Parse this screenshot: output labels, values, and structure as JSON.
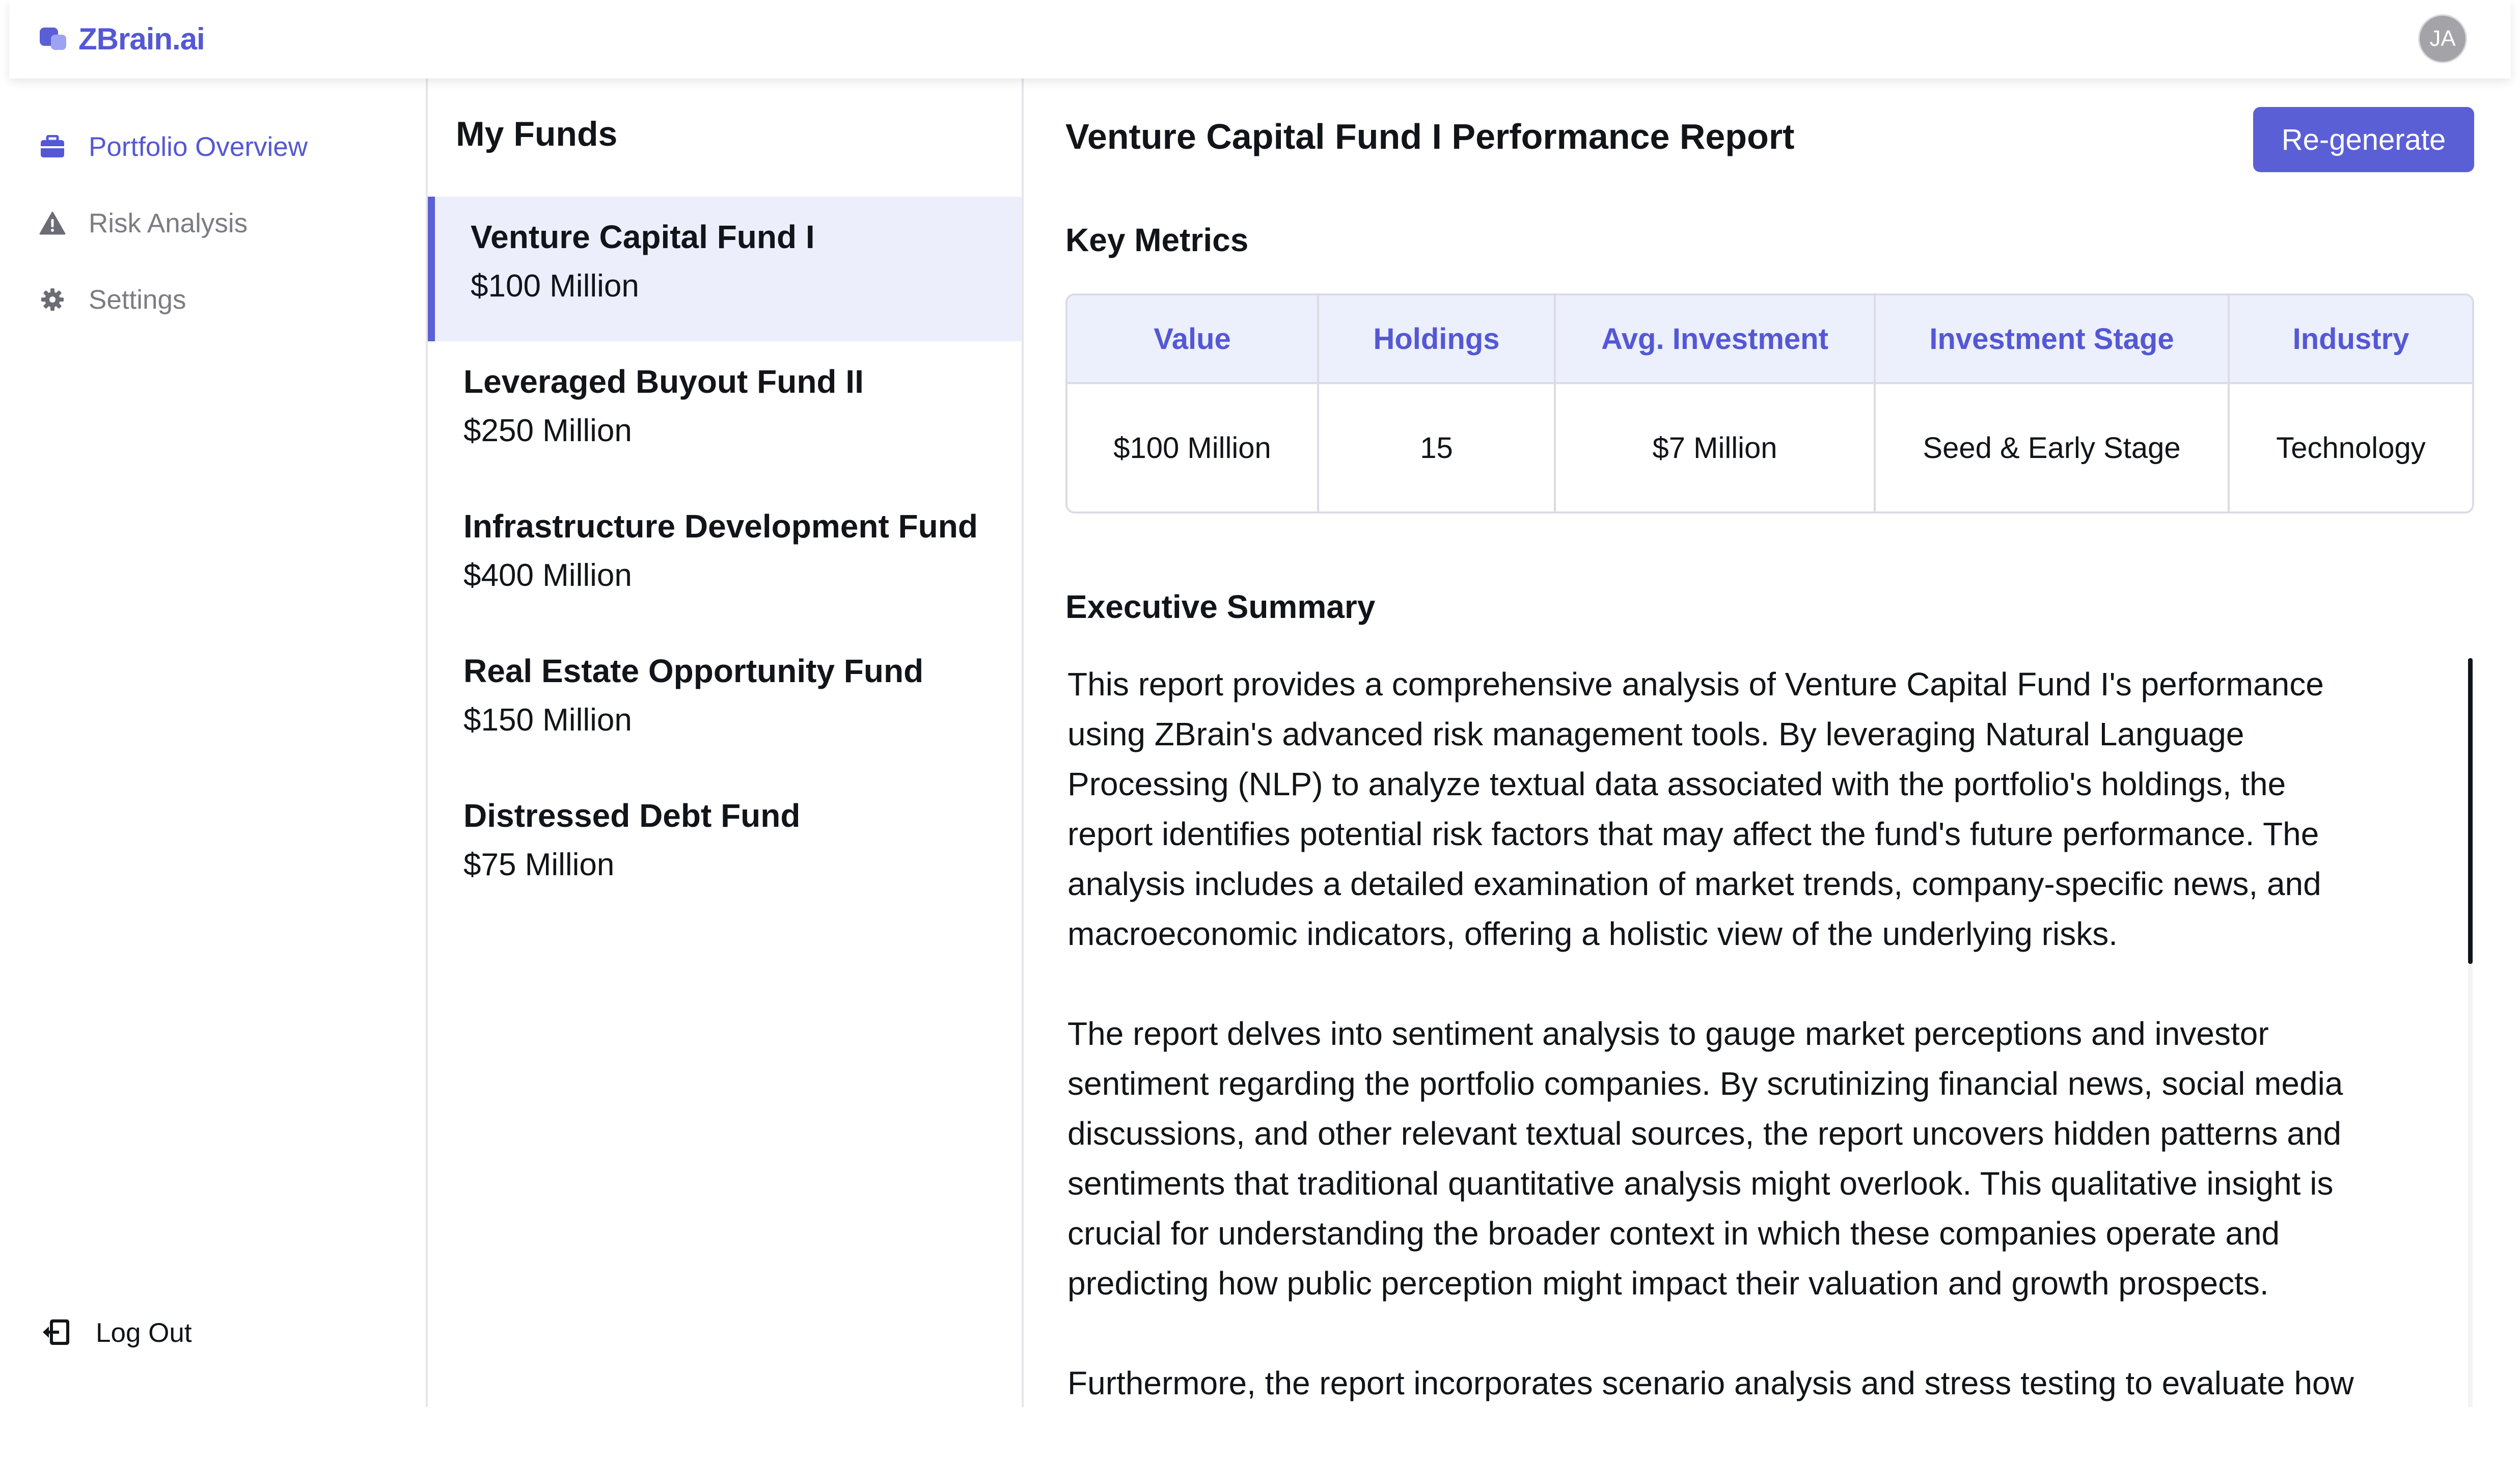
{
  "header": {
    "brand_name": "ZBrain.ai",
    "avatar_initials": "JA",
    "accent_color": "#5458d4"
  },
  "sidebar": {
    "items": [
      {
        "label": "Portfolio Overview",
        "icon": "briefcase-icon",
        "active": true
      },
      {
        "label": "Risk Analysis",
        "icon": "warning-icon",
        "active": false
      },
      {
        "label": "Settings",
        "icon": "gear-icon",
        "active": false
      }
    ],
    "logout_label": "Log Out"
  },
  "funds": {
    "title": "My Funds",
    "items": [
      {
        "name": "Venture Capital Fund I",
        "size": "$100 Million",
        "selected": true
      },
      {
        "name": "Leveraged Buyout Fund II",
        "size": "$250 Million",
        "selected": false
      },
      {
        "name": "Infrastructure Development Fund",
        "size": "$400 Million",
        "selected": false
      },
      {
        "name": "Real Estate Opportunity Fund",
        "size": "$150 Million",
        "selected": false
      },
      {
        "name": "Distressed Debt Fund",
        "size": "$75 Million",
        "selected": false
      }
    ]
  },
  "report": {
    "title": "Venture Capital Fund I Performance Report",
    "regenerate_label": "Re-generate",
    "key_metrics_title": "Key Metrics",
    "metrics_headers": [
      "Value",
      "Holdings",
      "Avg. Investment",
      "Investment Stage",
      "Industry"
    ],
    "metrics_values": [
      "$100 Million",
      "15",
      "$7 Million",
      "Seed & Early Stage",
      "Technology"
    ],
    "summary_title": "Executive Summary",
    "summary_paragraphs": [
      "This report provides a comprehensive analysis of Venture Capital Fund I's performance using ZBrain's advanced risk management tools. By leveraging Natural Language Processing (NLP) to analyze textual data associated with the portfolio's holdings, the report identifies potential risk factors that may affect the fund's future performance. The analysis includes a detailed examination of market trends, company-specific news, and macroeconomic indicators, offering a holistic view of the underlying risks.",
      "The report delves into sentiment analysis to gauge market perceptions and investor sentiment regarding the portfolio companies. By scrutinizing financial news, social media discussions, and other relevant textual sources, the report uncovers hidden patterns and sentiments that traditional quantitative analysis might overlook. This qualitative insight is crucial for understanding the broader context in which these companies operate and predicting how public perception might impact their valuation and growth prospects.",
      "Furthermore, the report incorporates scenario analysis and stress testing to evaluate how"
    ]
  }
}
